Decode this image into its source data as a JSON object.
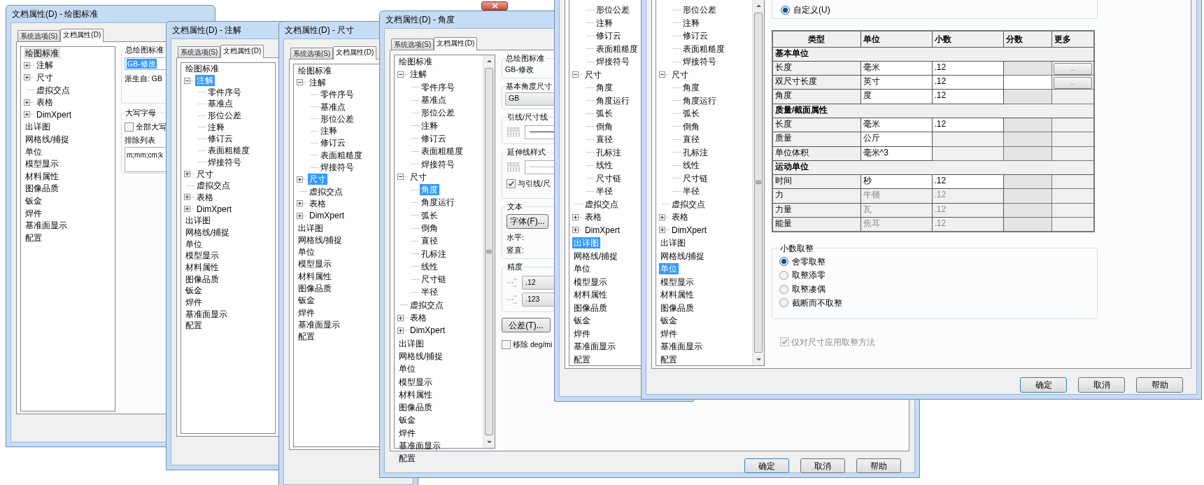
{
  "windows": [
    {
      "title": "文档属性(D) - 绘图标准",
      "tabs": [
        {
          "label": "系统选项(S)",
          "selected": false
        },
        {
          "label": "文档属性(D)",
          "selected": true
        }
      ],
      "tree": {
        "focused": false,
        "items": [
          {
            "label": "绘图标准",
            "selected": true,
            "children": [
              {
                "label": "注解",
                "expanded": false,
                "selected": false
              },
              {
                "label": "尺寸",
                "expanded": false,
                "selected": false
              },
              {
                "label": "虚拟交点",
                "selected": false
              },
              {
                "label": "表格",
                "expanded": false,
                "selected": false
              },
              {
                "label": "DimXpert",
                "expanded": false,
                "selected": false
              }
            ]
          },
          {
            "label": "出详图",
            "selected": false
          },
          {
            "label": "网格线/捕捉",
            "selected": false
          },
          {
            "label": "单位",
            "selected": false
          },
          {
            "label": "模型显示",
            "selected": false
          },
          {
            "label": "材料属性",
            "selected": false
          },
          {
            "label": "图像品质",
            "selected": false
          },
          {
            "label": "钣金",
            "selected": false
          },
          {
            "label": "焊件",
            "selected": false
          },
          {
            "label": "基准面显示",
            "selected": false
          },
          {
            "label": "配置",
            "selected": false
          }
        ]
      },
      "panel": {
        "kind": "drawing_standard",
        "standard_title": "总绘图标准",
        "standard_value": "GB-修改",
        "derived": "派生自: GB",
        "caps_title": "大写字母",
        "all_caps": {
          "label": "全部大写",
          "checked": false
        },
        "exclude_label": "排除列表",
        "exclude_value": "m;mm;cm;k"
      }
    },
    {
      "title": "文档属性(D) - 注解",
      "tabs": [
        {
          "label": "系统选项(S)",
          "selected": false
        },
        {
          "label": "文档属性(D)",
          "selected": true
        }
      ],
      "tree": {
        "focused": true,
        "items": [
          {
            "label": "绘图标准",
            "selected": false,
            "children": [
              {
                "label": "注解",
                "expanded": true,
                "selected": true,
                "children": [
                  {
                    "label": "零件序号",
                    "selected": false
                  },
                  {
                    "label": "基准点",
                    "selected": false
                  },
                  {
                    "label": "形位公差",
                    "selected": false
                  },
                  {
                    "label": "注释",
                    "selected": false
                  },
                  {
                    "label": "修订云",
                    "selected": false
                  },
                  {
                    "label": "表面粗糙度",
                    "selected": false
                  },
                  {
                    "label": "焊接符号",
                    "selected": false
                  }
                ]
              },
              {
                "label": "尺寸",
                "expanded": false,
                "selected": false
              },
              {
                "label": "虚拟交点",
                "selected": false
              },
              {
                "label": "表格",
                "expanded": false,
                "selected": false
              },
              {
                "label": "DimXpert",
                "expanded": false,
                "selected": false
              }
            ]
          },
          {
            "label": "出详图",
            "selected": false
          },
          {
            "label": "网格线/捕捉",
            "selected": false
          },
          {
            "label": "单位",
            "selected": false
          },
          {
            "label": "模型显示",
            "selected": false
          },
          {
            "label": "材料属性",
            "selected": false
          },
          {
            "label": "图像品质",
            "selected": false
          },
          {
            "label": "钣金",
            "selected": false
          },
          {
            "label": "焊件",
            "selected": false
          },
          {
            "label": "基准面显示",
            "selected": false
          },
          {
            "label": "配置",
            "selected": false
          }
        ]
      }
    },
    {
      "title": "文档属性(D) - 尺寸",
      "tabs": [
        {
          "label": "系统选项(S)",
          "selected": false
        },
        {
          "label": "文档属性(D)",
          "selected": true
        }
      ],
      "tree": {
        "focused": true,
        "items": [
          {
            "label": "绘图标准",
            "selected": false,
            "children": [
              {
                "label": "注解",
                "expanded": true,
                "selected": false,
                "children": [
                  {
                    "label": "零件序号",
                    "selected": false
                  },
                  {
                    "label": "基准点",
                    "selected": false
                  },
                  {
                    "label": "形位公差",
                    "selected": false
                  },
                  {
                    "label": "注释",
                    "selected": false
                  },
                  {
                    "label": "修订云",
                    "selected": false
                  },
                  {
                    "label": "表面粗糙度",
                    "selected": false
                  },
                  {
                    "label": "焊接符号",
                    "selected": false
                  }
                ]
              },
              {
                "label": "尺寸",
                "expanded": false,
                "selected": true
              },
              {
                "label": "虚拟交点",
                "selected": false
              },
              {
                "label": "表格",
                "expanded": false,
                "selected": false
              },
              {
                "label": "DimXpert",
                "expanded": false,
                "selected": false
              }
            ]
          },
          {
            "label": "出详图",
            "selected": false
          },
          {
            "label": "网格线/捕捉",
            "selected": false
          },
          {
            "label": "单位",
            "selected": false
          },
          {
            "label": "模型显示",
            "selected": false
          },
          {
            "label": "材料属性",
            "selected": false
          },
          {
            "label": "图像品质",
            "selected": false
          },
          {
            "label": "钣金",
            "selected": false
          },
          {
            "label": "焊件",
            "selected": false
          },
          {
            "label": "基准面显示",
            "selected": false
          },
          {
            "label": "配置",
            "selected": false
          }
        ]
      }
    },
    {
      "title": "文档属性(D) - 角度",
      "tabs": [
        {
          "label": "系统选项(S)",
          "selected": false
        },
        {
          "label": "文档属性(D)",
          "selected": true
        }
      ],
      "tree": {
        "focused": true,
        "items": [
          {
            "label": "绘图标准",
            "selected": false,
            "children": [
              {
                "label": "注解",
                "expanded": true,
                "selected": false,
                "children": [
                  {
                    "label": "零件序号",
                    "selected": false
                  },
                  {
                    "label": "基准点",
                    "selected": false
                  },
                  {
                    "label": "形位公差",
                    "selected": false
                  },
                  {
                    "label": "注释",
                    "selected": false
                  },
                  {
                    "label": "修订云",
                    "selected": false
                  },
                  {
                    "label": "表面粗糙度",
                    "selected": false
                  },
                  {
                    "label": "焊接符号",
                    "selected": false
                  }
                ]
              },
              {
                "label": "尺寸",
                "expanded": true,
                "selected": false,
                "children": [
                  {
                    "label": "角度",
                    "selected": true
                  },
                  {
                    "label": "角度运行",
                    "selected": false
                  },
                  {
                    "label": "弧长",
                    "selected": false
                  },
                  {
                    "label": "倒角",
                    "selected": false
                  },
                  {
                    "label": "直径",
                    "selected": false
                  },
                  {
                    "label": "孔标注",
                    "selected": false
                  },
                  {
                    "label": "线性",
                    "selected": false
                  },
                  {
                    "label": "尺寸链",
                    "selected": false
                  },
                  {
                    "label": "半径",
                    "selected": false
                  }
                ]
              },
              {
                "label": "虚拟交点",
                "selected": false
              },
              {
                "label": "表格",
                "expanded": false,
                "selected": false
              },
              {
                "label": "DimXpert",
                "expanded": false,
                "selected": false
              }
            ]
          },
          {
            "label": "出详图",
            "selected": false
          },
          {
            "label": "网格线/捕捉",
            "selected": false
          },
          {
            "label": "单位",
            "selected": false
          },
          {
            "label": "模型显示",
            "selected": false
          },
          {
            "label": "材料属性",
            "selected": false
          },
          {
            "label": "图像品质",
            "selected": false
          },
          {
            "label": "钣金",
            "selected": false
          },
          {
            "label": "焊件",
            "selected": false
          },
          {
            "label": "基准面显示",
            "selected": false
          },
          {
            "label": "配置",
            "selected": false
          }
        ]
      },
      "panel": {
        "kind": "angle",
        "standard_title": "总绘图标准",
        "standard_value": "GB-修改",
        "base_title": "基本角度尺寸",
        "base_value": "GB",
        "leader_title": "引线/尺寸线",
        "ext_title": "延伸线样式",
        "same_as": {
          "label": "与引线/尺",
          "checked": true
        },
        "text_title": "文本",
        "font_button": "字体(F)...",
        "horizontal": "水平:",
        "vertical": "竖直:",
        "precision_title": "精度",
        "primary": ".12",
        "dual": ".123",
        "tolerance_button": "公差(T)...",
        "remove": {
          "label": "移除 deg/mi",
          "checked": false
        }
      },
      "buttons": [
        {
          "label": "确定",
          "default": true
        },
        {
          "label": "取消",
          "default": false
        },
        {
          "label": "帮助",
          "default": false
        }
      ]
    },
    {
      "tree": {
        "focused": true,
        "items": [
          {
            "children": [
              {
                "children": [
                  {
                    "label": "形位公差",
                    "selected": false
                  },
                  {
                    "label": "注释",
                    "selected": false
                  },
                  {
                    "label": "修订云",
                    "selected": false
                  },
                  {
                    "label": "表面粗糙度",
                    "selected": false
                  },
                  {
                    "label": "焊接符号",
                    "selected": false
                  }
                ]
              },
              {
                "label": "尺寸",
                "expanded": true,
                "selected": false,
                "children": [
                  {
                    "label": "角度",
                    "selected": false
                  },
                  {
                    "label": "角度运行",
                    "selected": false
                  },
                  {
                    "label": "弧长",
                    "selected": false
                  },
                  {
                    "label": "倒角",
                    "selected": false
                  },
                  {
                    "label": "直径",
                    "selected": false
                  },
                  {
                    "label": "孔标注",
                    "selected": false
                  },
                  {
                    "label": "线性",
                    "selected": false
                  },
                  {
                    "label": "尺寸链",
                    "selected": false
                  },
                  {
                    "label": "半径",
                    "selected": false
                  }
                ]
              },
              {
                "label": "虚拟交点",
                "selected": false
              },
              {
                "label": "表格",
                "expanded": false,
                "selected": false
              },
              {
                "label": "DimXpert",
                "expanded": false,
                "selected": false
              }
            ]
          },
          {
            "label": "出详图",
            "selected": true
          },
          {
            "label": "网格线/捕捉",
            "selected": false
          },
          {
            "label": "单位",
            "selected": false
          },
          {
            "label": "模型显示",
            "selected": false
          },
          {
            "label": "材料属性",
            "selected": false
          },
          {
            "label": "图像品质",
            "selected": false
          },
          {
            "label": "钣金",
            "selected": false
          },
          {
            "label": "焊件",
            "selected": false
          },
          {
            "label": "基准面显示",
            "selected": false
          },
          {
            "label": "配置",
            "selected": false
          }
        ]
      }
    },
    {
      "tree": {
        "focused": true,
        "items": [
          {
            "children": [
              {
                "children": [
                  {
                    "label": "形位公差",
                    "selected": false
                  },
                  {
                    "label": "注释",
                    "selected": false
                  },
                  {
                    "label": "修订云",
                    "selected": false
                  },
                  {
                    "label": "表面粗糙度",
                    "selected": false
                  },
                  {
                    "label": "焊接符号",
                    "selected": false
                  }
                ]
              },
              {
                "label": "尺寸",
                "expanded": true,
                "selected": false,
                "children": [
                  {
                    "label": "角度",
                    "selected": false
                  },
                  {
                    "label": "角度运行",
                    "selected": false
                  },
                  {
                    "label": "弧长",
                    "selected": false
                  },
                  {
                    "label": "倒角",
                    "selected": false
                  },
                  {
                    "label": "直径",
                    "selected": false
                  },
                  {
                    "label": "孔标注",
                    "selected": false
                  },
                  {
                    "label": "线性",
                    "selected": false
                  },
                  {
                    "label": "尺寸链",
                    "selected": false
                  },
                  {
                    "label": "半径",
                    "selected": false
                  }
                ]
              },
              {
                "label": "虚拟交点",
                "selected": false
              },
              {
                "label": "表格",
                "expanded": false,
                "selected": false
              },
              {
                "label": "DimXpert",
                "expanded": false,
                "selected": false
              }
            ]
          },
          {
            "label": "出详图",
            "selected": false
          },
          {
            "label": "网格线/捕捉",
            "selected": false
          },
          {
            "label": "单位",
            "selected": true
          },
          {
            "label": "模型显示",
            "selected": false
          },
          {
            "label": "材料属性",
            "selected": false
          },
          {
            "label": "图像品质",
            "selected": false
          },
          {
            "label": "钣金",
            "selected": false
          },
          {
            "label": "焊件",
            "selected": false
          },
          {
            "label": "基准面显示",
            "selected": false
          },
          {
            "label": "配置",
            "selected": false
          }
        ]
      },
      "panel": {
        "kind": "units",
        "custom": {
          "label": "自定义(U)",
          "selected": true
        },
        "table": {
          "columns": [
            "类型",
            "单位",
            "小数",
            "分数",
            "更多"
          ],
          "rows": [
            {
              "kind": "section",
              "label": "基本单位"
            },
            {
              "kind": "unit",
              "type": "长度",
              "unit": "毫米",
              "decimal": ".12",
              "disabled": false,
              "fraction_editable": false,
              "more": "..."
            },
            {
              "kind": "unit",
              "type": "双尺寸长度",
              "unit": "英寸",
              "decimal": ".12",
              "disabled": false,
              "fraction_editable": true,
              "more": "..."
            },
            {
              "kind": "unit",
              "type": "角度",
              "unit": "度",
              "decimal": ".12",
              "disabled": false,
              "fraction_editable": false
            },
            {
              "kind": "section",
              "label": "质量/截面属性"
            },
            {
              "kind": "unit",
              "type": "长度",
              "unit": "毫米",
              "decimal": ".12",
              "disabled": false,
              "fraction_editable": false
            },
            {
              "kind": "unit",
              "type": "质量",
              "unit": "公斤",
              "disabled": false,
              "fraction_editable": false
            },
            {
              "kind": "unit",
              "type": "单位体积",
              "unit": "毫米^3",
              "disabled": false,
              "fraction_editable": false
            },
            {
              "kind": "section",
              "label": "运动单位"
            },
            {
              "kind": "unit",
              "type": "时间",
              "unit": "秒",
              "decimal": ".12",
              "disabled": false,
              "fraction_editable": false
            },
            {
              "kind": "unit",
              "type": "力",
              "unit": "牛顿",
              "decimal": ".12",
              "disabled": true,
              "fraction_editable": false
            },
            {
              "kind": "unit",
              "type": "力量",
              "unit": "瓦",
              "decimal": ".12",
              "disabled": true,
              "fraction_editable": false
            },
            {
              "kind": "unit",
              "type": "能量",
              "unit": "焦耳",
              "decimal": ".12",
              "disabled": true,
              "fraction_editable": false
            }
          ]
        },
        "rounding": {
          "title": "小数取整",
          "options": [
            {
              "label": "舍零取整",
              "selected": true
            },
            {
              "label": "取整添零",
              "selected": false
            },
            {
              "label": "取整凑偶",
              "selected": false
            },
            {
              "label": "截断而不取整",
              "selected": false
            }
          ]
        },
        "dims_only": {
          "label": "仅对尺寸应用取整方法",
          "checked": true,
          "disabled": true
        }
      },
      "buttons": [
        {
          "label": "确定",
          "default": true
        },
        {
          "label": "取消",
          "default": false
        },
        {
          "label": "帮助",
          "default": false
        }
      ]
    }
  ]
}
